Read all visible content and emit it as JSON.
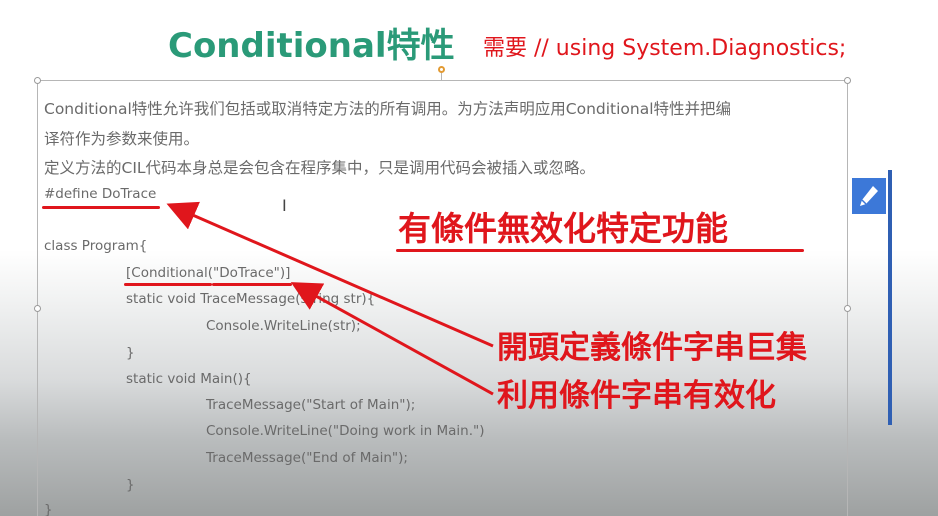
{
  "slide": {
    "title": "Conditional特性",
    "note": "需要 // using System.Diagnostics;"
  },
  "body": {
    "para1_line1": "Conditional特性允许我们包括或取消特定方法的所有调用。为方法声明应用Conditional特性并把编",
    "para1_line2": "译符作为参数来使用。",
    "para2": "定义方法的CIL代码本身总是会包含在程序集中，只是调用代码会被插入或忽略。",
    "define_line": "#define DoTrace"
  },
  "code": {
    "class_decl": "class Program{",
    "attribute": "[Conditional(\"DoTrace\")]",
    "trace_sig": "static void TraceMessage(string str){",
    "trace_body": "Console.WriteLine(str);",
    "close1": "}",
    "main_sig": "static void Main(){",
    "main1": "TraceMessage(\"Start of Main\");",
    "main2": "Console.WriteLine(\"Doing work in Main.\")",
    "main3": "TraceMessage(\"End of Main\");",
    "close2": "}",
    "close3": "}"
  },
  "callouts": {
    "headline": "有條件無效化特定功能",
    "define_note": "開頭定義條件字串巨集",
    "enable_note": "利用條件字串有效化"
  },
  "colors": {
    "title_green": "#2a9a78",
    "annotation_red": "#e0161c",
    "body_text": "#6a6a6a",
    "edit_button": "#3c78d8"
  },
  "icons": {
    "edit": "pencil-icon",
    "cursor": "text-cursor-icon"
  }
}
